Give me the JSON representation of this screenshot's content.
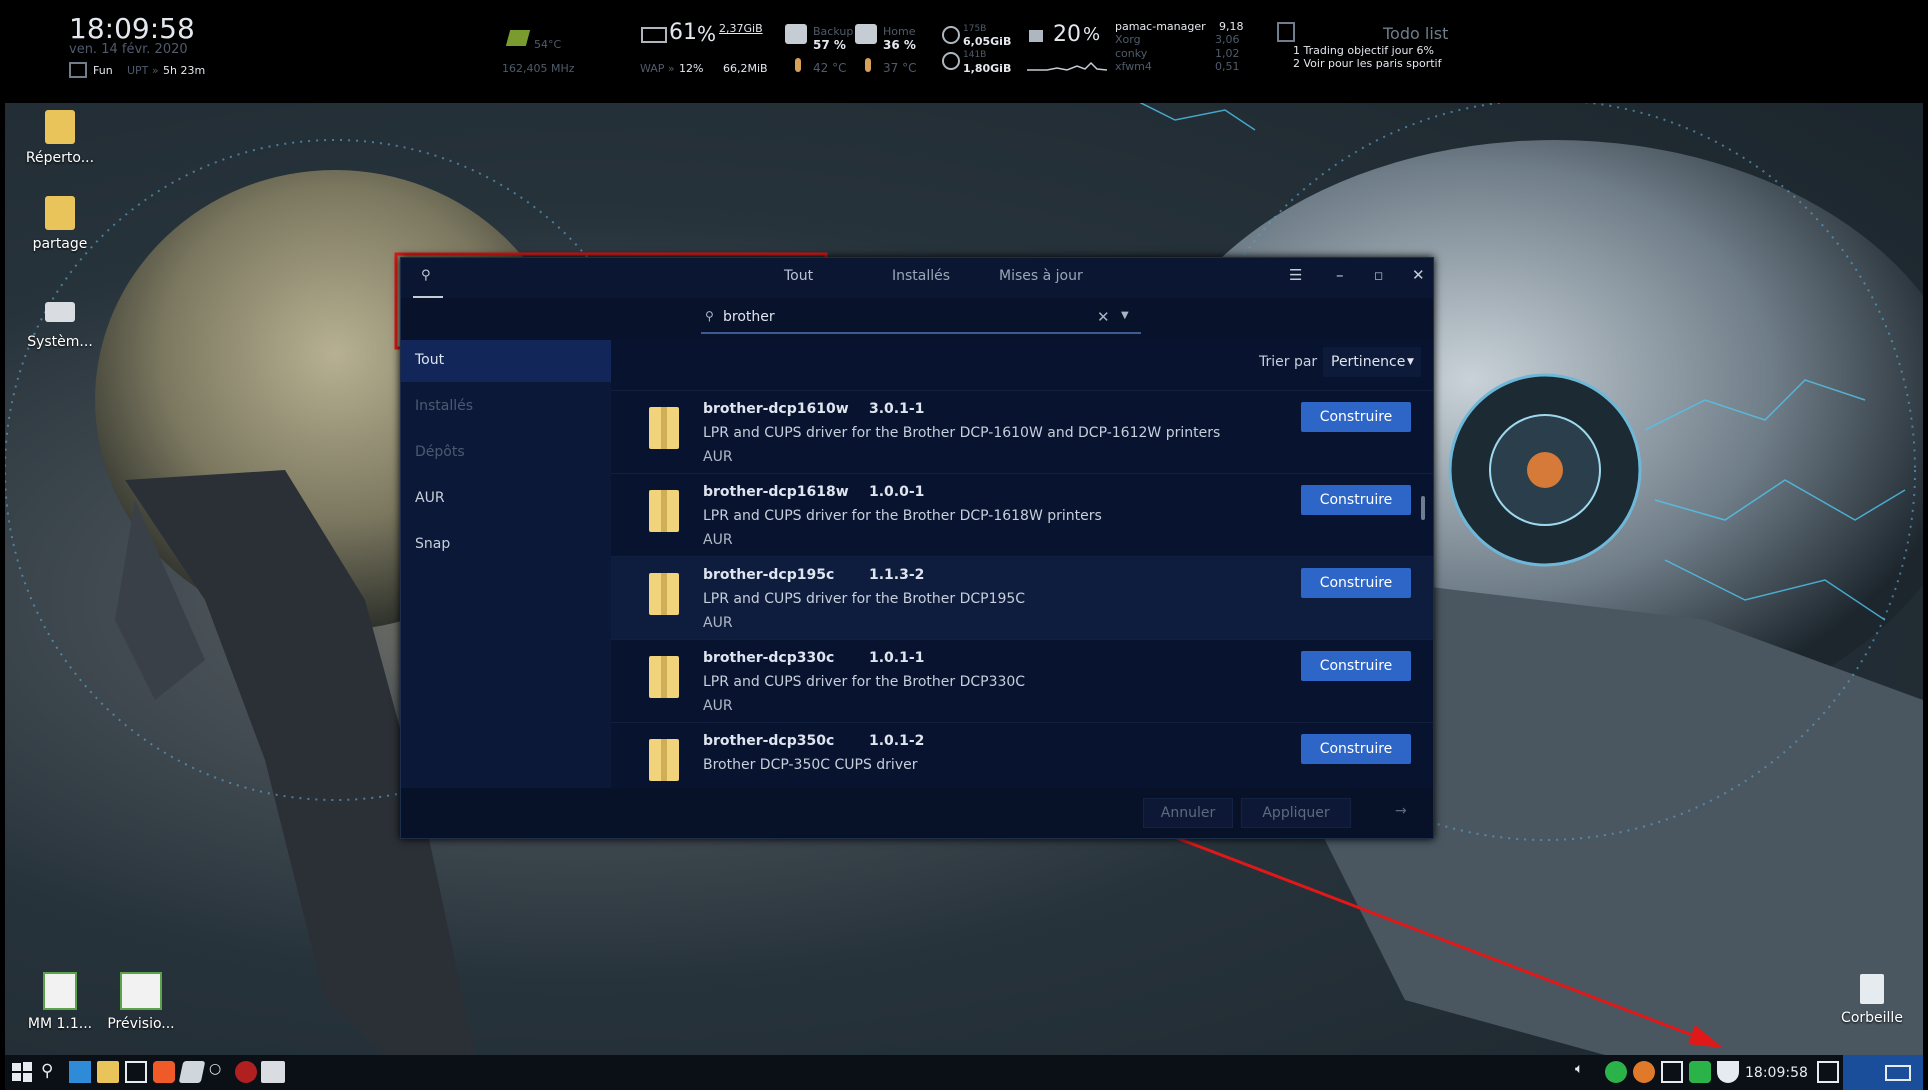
{
  "conky": {
    "time": "18:09:58",
    "date": "ven. 14 févr. 2020",
    "user": "Fun",
    "uptime_label": "UPT »",
    "uptime": "5h 23m",
    "gpu_temp": "54°C",
    "gpu_freq": "162,405 MHz",
    "ram_percent": "61",
    "ram_pct_sign": "%",
    "ram_used": "2,37GiB",
    "swap_label": "WAP »",
    "swap_percent": "12%",
    "swap_used": "66,2MiB",
    "backup_label": "Backup",
    "backup_percent": "57 %",
    "home_label": "Home",
    "home_percent": "36 %",
    "temp1": "42 °C",
    "temp2": "37 °C",
    "disk1_total": "175B",
    "disk1_used": "6,05GiB",
    "disk2_total": "141B",
    "disk2_used": "1,80GiB",
    "cpu_percent": "20",
    "cpu_pct_sign": "%",
    "processes": [
      {
        "name": "pamac-manager",
        "value": "9,18"
      },
      {
        "name": "Xorg",
        "value": "3,06"
      },
      {
        "name": "conky",
        "value": "1,02"
      },
      {
        "name": "xfwm4",
        "value": "0,51"
      }
    ],
    "todo_title": "Todo list",
    "todo_items": [
      "1 Trading objectif jour 6%",
      "2 Voir pour les paris sportif"
    ]
  },
  "desktop_icons": [
    {
      "label": "Réperto..."
    },
    {
      "label": "partage"
    },
    {
      "label": "Systèm..."
    },
    {
      "label": "MM 1.1..."
    },
    {
      "label": "Prévisio..."
    },
    {
      "label": "Corbeille"
    }
  ],
  "window": {
    "tabs": [
      "Tout",
      "Installés",
      "Mises à jour"
    ],
    "search_value": "brother",
    "sidebar": [
      "Tout",
      "Installés",
      "Dépôts",
      "AUR",
      "Snap"
    ],
    "sort_label": "Trier par",
    "sort_value": "Pertinence",
    "packages": [
      {
        "name": "brother-dcp1610w",
        "version": "3.0.1-1",
        "description": "LPR and CUPS driver for the Brother DCP-1610W and DCP-1612W printers",
        "repo": "AUR",
        "action": "Construire"
      },
      {
        "name": "brother-dcp1618w",
        "version": "1.0.0-1",
        "description": "LPR and CUPS driver for the Brother DCP-1618W printers",
        "repo": "AUR",
        "action": "Construire"
      },
      {
        "name": "brother-dcp195c",
        "version": "1.1.3-2",
        "description": "LPR and CUPS driver for the Brother DCP195C",
        "repo": "AUR",
        "action": "Construire"
      },
      {
        "name": "brother-dcp330c",
        "version": "1.0.1-1",
        "description": "LPR and CUPS driver for the Brother DCP330C",
        "repo": "AUR",
        "action": "Construire"
      },
      {
        "name": "brother-dcp350c",
        "version": "1.0.1-2",
        "description": "Brother DCP-350C CUPS driver",
        "repo": "AUR",
        "action": "Construire"
      }
    ],
    "footer": {
      "cancel": "Annuler",
      "apply": "Appliquer"
    }
  },
  "taskbar": {
    "clock": "18:09:58"
  }
}
